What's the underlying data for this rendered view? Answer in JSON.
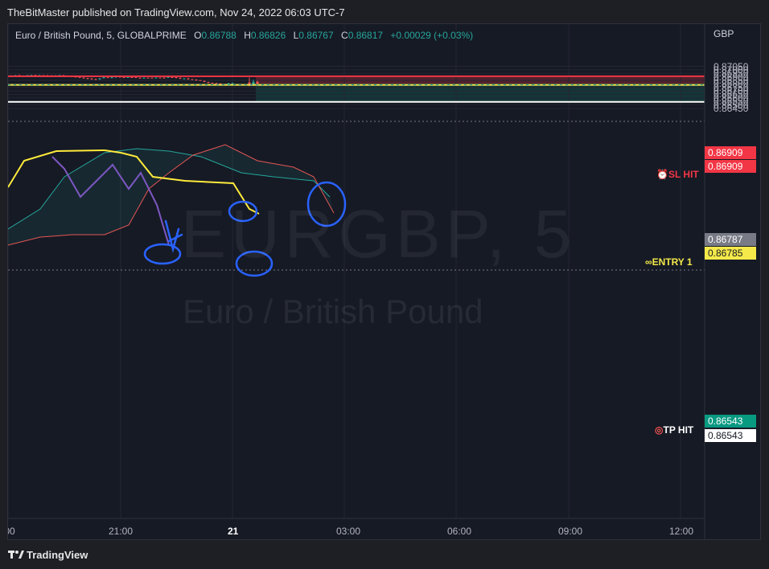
{
  "header": {
    "published_text": "TheBitMaster published on TradingView.com, Nov 24, 2022 06:03 UTC-7"
  },
  "symbol": {
    "title": "Euro / British Pound, 5, GLOBALPRIME",
    "o_label": "O",
    "o_value": "0.86788",
    "h_label": "H",
    "h_value": "0.86826",
    "l_label": "L",
    "l_value": "0.86767",
    "c_label": "C",
    "c_value": "0.86817",
    "change": "+0.00029 (+0.03%)"
  },
  "currency": "GBP",
  "watermark": {
    "ticker": "EURGBP, 5",
    "name": "Euro / British Pound"
  },
  "y_ticks": [
    "0.87050",
    "0.87000",
    "0.86950",
    "0.86900",
    "0.86850",
    "0.86800",
    "0.86750",
    "0.86700",
    "0.86650",
    "0.86600",
    "0.86550",
    "0.86500",
    "0.86450"
  ],
  "x_ticks": [
    ":00",
    "21:00",
    "21",
    "03:00",
    "06:00",
    "09:00",
    "12:00"
  ],
  "price_tags": {
    "sl_top": "0.86909",
    "sl_bottom": "0.86909",
    "current": "0.86787",
    "entry": "0.86785",
    "tp_top": "0.86543",
    "tp_bottom": "0.86543"
  },
  "labels": {
    "sl": "SL HIT",
    "entry": "ENTRY 1",
    "tp": "TP HIT"
  },
  "footer": {
    "brand": "TradingView"
  },
  "colors": {
    "up": "#26a69a",
    "down": "#ef5350",
    "sl_zone": "#f23645",
    "tp_zone": "#089981",
    "entry_line": "#f5e94a",
    "tenkan": "#ffeb3b",
    "kijun": "#7e57c2",
    "annotation": "#2962ff"
  },
  "chart_data": {
    "type": "candlestick",
    "title": "Euro / British Pound, 5, GLOBALPRIME",
    "ylabel": "GBP",
    "ylim": [
      0.864,
      0.8711
    ],
    "levels": {
      "stop_loss": 0.86909,
      "entry": 0.86785,
      "take_profit": 0.86543,
      "last": 0.86787
    }
  }
}
